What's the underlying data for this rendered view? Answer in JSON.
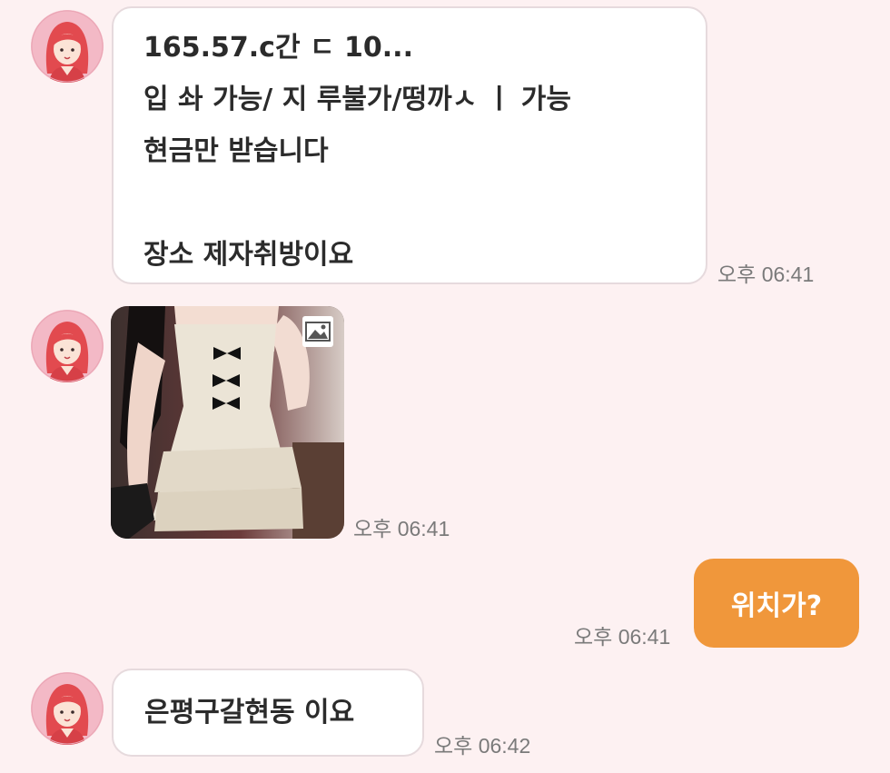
{
  "messages": [
    {
      "direction": "incoming",
      "type": "text",
      "text": "165.57.c간  ㄷ 10...\n입  솨  가능/ 지  루불가/떵까ㅅ  ㅣ 가능\n현금만 받습니다\n\n장소 제자취방이요",
      "time": "오후 06:41"
    },
    {
      "direction": "incoming",
      "type": "photo",
      "icon": "image-icon",
      "time": "오후 06:41"
    },
    {
      "direction": "outgoing",
      "type": "text",
      "text": "위치가?",
      "time": "오후 06:41"
    },
    {
      "direction": "incoming",
      "type": "text",
      "text": "은평구갈현동 이요",
      "time": "오후 06:42"
    }
  ],
  "colors": {
    "background": "#fdf1f2",
    "outgoing_bubble": "#f0973b",
    "incoming_bubble": "#ffffff",
    "avatar_bg": "#f3b9c6"
  }
}
